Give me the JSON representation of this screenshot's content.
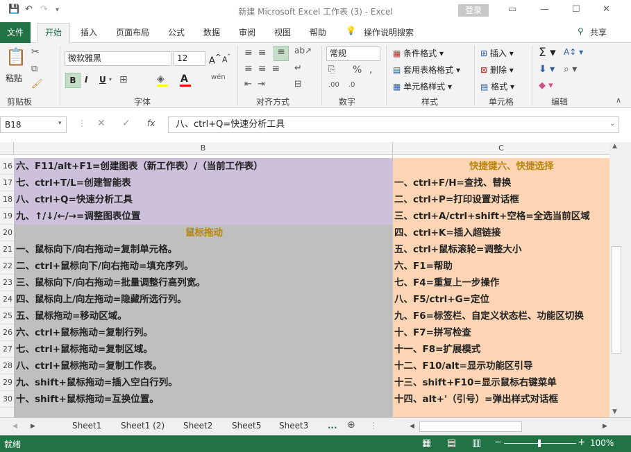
{
  "window": {
    "title": "新建 Microsoft Excel 工作表 (3)  -  Excel",
    "login": "登录"
  },
  "tabs": {
    "file": "文件",
    "items": [
      "开始",
      "插入",
      "页面布局",
      "公式",
      "数据",
      "审阅",
      "视图",
      "帮助"
    ],
    "tell_me": "操作说明搜索",
    "share": "共享"
  },
  "ribbon": {
    "clipboard": {
      "label": "剪贴板",
      "paste": "粘贴"
    },
    "font": {
      "label": "字体",
      "name": "微软雅黑",
      "size": "12",
      "bold": "B",
      "italic": "I",
      "underline": "U"
    },
    "alignment": {
      "label": "对齐方式"
    },
    "number": {
      "label": "数字",
      "format": "常规"
    },
    "styles": {
      "label": "样式",
      "conditional": "条件格式",
      "table": "套用表格格式",
      "cell": "单元格样式"
    },
    "cells": {
      "label": "单元格",
      "insert": "插入",
      "delete": "删除",
      "format": "格式"
    },
    "editing": {
      "label": "编辑"
    }
  },
  "formula_bar": {
    "name_box": "B18",
    "fx": "fx",
    "content": "八、ctrl+Q=快速分析工具"
  },
  "columns": {
    "b": "B",
    "c": "C"
  },
  "rows": [
    {
      "num": "16",
      "b": "六、F11/alt+F1=创建图表（新工作表）/（当前工作表）",
      "c": "快捷键六、快捷选择"
    },
    {
      "num": "17",
      "b": "七、ctrl+T/L=创建智能表",
      "c": "一、ctrl+F/H=查找、替换"
    },
    {
      "num": "18",
      "b": "八、ctrl+Q=快速分析工具",
      "c": "二、ctrl+P=打印设置对话框"
    },
    {
      "num": "19",
      "b": "九、↑/↓/←/→=调整图表位置",
      "c": "三、ctrl+A/ctrl+shift+空格=全选当前区域"
    },
    {
      "num": "20",
      "b": "鼠标拖动",
      "c": "四、ctrl+K=插入超链接"
    },
    {
      "num": "21",
      "b": "一、鼠标向下/向右拖动=复制单元格。",
      "c": "五、ctrl+鼠标滚轮=调整大小"
    },
    {
      "num": "22",
      "b": "二、ctrl+鼠标向下/向右拖动=填充序列。",
      "c": "六、F1=帮助"
    },
    {
      "num": "23",
      "b": "三、鼠标向下/向右拖动=批量调整行高列宽。",
      "c": "七、F4=重复上一步操作"
    },
    {
      "num": "24",
      "b": "四、鼠标向上/向左拖动=隐藏所选行列。",
      "c": "八、F5/ctrl+G=定位"
    },
    {
      "num": "25",
      "b": "五、鼠标拖动=移动区域。",
      "c": "九、F6=标签栏、自定义状态栏、功能区切换"
    },
    {
      "num": "26",
      "b": "六、ctrl+鼠标拖动=复制行列。",
      "c": "十、F7=拼写检查"
    },
    {
      "num": "27",
      "b": "七、ctrl+鼠标拖动=复制区域。",
      "c": "十一、F8=扩展模式"
    },
    {
      "num": "28",
      "b": "八、ctrl+鼠标拖动=复制工作表。",
      "c": "十二、F10/alt=显示功能区引导"
    },
    {
      "num": "29",
      "b": "九、shift+鼠标拖动=插入空白行列。",
      "c": "十三、shift+F10=显示鼠标右键菜单"
    },
    {
      "num": "30",
      "b": "十、shift+鼠标拖动=互换位置。",
      "c": "十四、alt+'（引号）=弹出样式对话框"
    }
  ],
  "sheets": [
    "Sheet1",
    "Sheet1 (2)",
    "Sheet2",
    "Sheet5",
    "Sheet3"
  ],
  "more_sheets": "...",
  "status": {
    "ready": "就绪",
    "zoom": "100%"
  },
  "colors": {
    "excel_green": "#217346",
    "purple_fill": "#ccc0da",
    "gray_fill": "#bfbfbf",
    "peach_fill": "#fcd5b4",
    "heading_gold": "#b8860b"
  }
}
